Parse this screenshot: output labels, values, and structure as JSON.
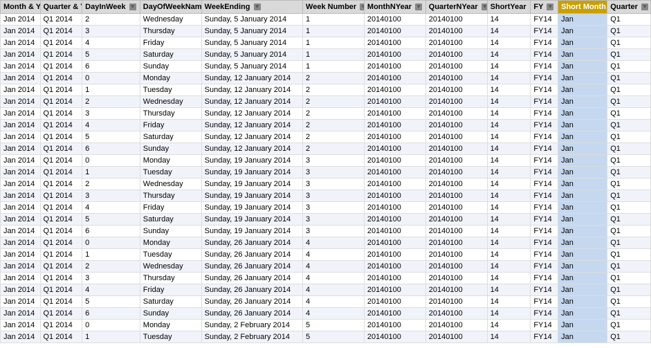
{
  "columns": [
    {
      "key": "month",
      "label": "Month & Year",
      "class": "col-month",
      "active": false
    },
    {
      "key": "quarter",
      "label": "Quarter & Year",
      "class": "col-quarter",
      "active": false
    },
    {
      "key": "dayinweek",
      "label": "DayInWeek",
      "class": "col-dayinweek",
      "active": false
    },
    {
      "key": "dayofweekname",
      "label": "DayOfWeekName",
      "class": "col-dayofweekname",
      "active": false
    },
    {
      "key": "weekending",
      "label": "WeekEnding",
      "class": "col-weekending",
      "active": false
    },
    {
      "key": "weeknumber",
      "label": "Week Number",
      "class": "col-weeknumber",
      "active": false
    },
    {
      "key": "monthnyear",
      "label": "MonthNYear",
      "class": "col-monthnyear",
      "active": false
    },
    {
      "key": "quarternyear",
      "label": "QuarterNYear",
      "class": "col-quarternyear",
      "active": false
    },
    {
      "key": "shortyear",
      "label": "ShortYear",
      "class": "col-shortyear",
      "active": false
    },
    {
      "key": "fy",
      "label": "FY",
      "class": "col-fy",
      "active": false
    },
    {
      "key": "shortmonth",
      "label": "Short Month",
      "class": "col-shortmonth",
      "active": true
    },
    {
      "key": "quarterend",
      "label": "Quarter",
      "class": "col-quarterend",
      "active": false
    }
  ],
  "rows": [
    {
      "month": "Jan 2014",
      "quarter": "Q1 2014",
      "dayinweek": "2",
      "dayofweekname": "Wednesday",
      "weekending": "Sunday, 5 January 2014",
      "weeknumber": "1",
      "monthnyear": "20140100",
      "quarternyear": "20140100",
      "shortyear": "14",
      "fy": "FY14",
      "shortmonth": "Jan",
      "quarterend": "Q1"
    },
    {
      "month": "Jan 2014",
      "quarter": "Q1 2014",
      "dayinweek": "3",
      "dayofweekname": "Thursday",
      "weekending": "Sunday, 5 January 2014",
      "weeknumber": "1",
      "monthnyear": "20140100",
      "quarternyear": "20140100",
      "shortyear": "14",
      "fy": "FY14",
      "shortmonth": "Jan",
      "quarterend": "Q1"
    },
    {
      "month": "Jan 2014",
      "quarter": "Q1 2014",
      "dayinweek": "4",
      "dayofweekname": "Friday",
      "weekending": "Sunday, 5 January 2014",
      "weeknumber": "1",
      "monthnyear": "20140100",
      "quarternyear": "20140100",
      "shortyear": "14",
      "fy": "FY14",
      "shortmonth": "Jan",
      "quarterend": "Q1"
    },
    {
      "month": "Jan 2014",
      "quarter": "Q1 2014",
      "dayinweek": "5",
      "dayofweekname": "Saturday",
      "weekending": "Sunday, 5 January 2014",
      "weeknumber": "1",
      "monthnyear": "20140100",
      "quarternyear": "20140100",
      "shortyear": "14",
      "fy": "FY14",
      "shortmonth": "Jan",
      "quarterend": "Q1"
    },
    {
      "month": "Jan 2014",
      "quarter": "Q1 2014",
      "dayinweek": "6",
      "dayofweekname": "Sunday",
      "weekending": "Sunday, 5 January 2014",
      "weeknumber": "1",
      "monthnyear": "20140100",
      "quarternyear": "20140100",
      "shortyear": "14",
      "fy": "FY14",
      "shortmonth": "Jan",
      "quarterend": "Q1"
    },
    {
      "month": "Jan 2014",
      "quarter": "Q1 2014",
      "dayinweek": "0",
      "dayofweekname": "Monday",
      "weekending": "Sunday, 12 January 2014",
      "weeknumber": "2",
      "monthnyear": "20140100",
      "quarternyear": "20140100",
      "shortyear": "14",
      "fy": "FY14",
      "shortmonth": "Jan",
      "quarterend": "Q1"
    },
    {
      "month": "Jan 2014",
      "quarter": "Q1 2014",
      "dayinweek": "1",
      "dayofweekname": "Tuesday",
      "weekending": "Sunday, 12 January 2014",
      "weeknumber": "2",
      "monthnyear": "20140100",
      "quarternyear": "20140100",
      "shortyear": "14",
      "fy": "FY14",
      "shortmonth": "Jan",
      "quarterend": "Q1"
    },
    {
      "month": "Jan 2014",
      "quarter": "Q1 2014",
      "dayinweek": "2",
      "dayofweekname": "Wednesday",
      "weekending": "Sunday, 12 January 2014",
      "weeknumber": "2",
      "monthnyear": "20140100",
      "quarternyear": "20140100",
      "shortyear": "14",
      "fy": "FY14",
      "shortmonth": "Jan",
      "quarterend": "Q1"
    },
    {
      "month": "Jan 2014",
      "quarter": "Q1 2014",
      "dayinweek": "3",
      "dayofweekname": "Thursday",
      "weekending": "Sunday, 12 January 2014",
      "weeknumber": "2",
      "monthnyear": "20140100",
      "quarternyear": "20140100",
      "shortyear": "14",
      "fy": "FY14",
      "shortmonth": "Jan",
      "quarterend": "Q1"
    },
    {
      "month": "Jan 2014",
      "quarter": "Q1 2014",
      "dayinweek": "4",
      "dayofweekname": "Friday",
      "weekending": "Sunday, 12 January 2014",
      "weeknumber": "2",
      "monthnyear": "20140100",
      "quarternyear": "20140100",
      "shortyear": "14",
      "fy": "FY14",
      "shortmonth": "Jan",
      "quarterend": "Q1"
    },
    {
      "month": "Jan 2014",
      "quarter": "Q1 2014",
      "dayinweek": "5",
      "dayofweekname": "Saturday",
      "weekending": "Sunday, 12 January 2014",
      "weeknumber": "2",
      "monthnyear": "20140100",
      "quarternyear": "20140100",
      "shortyear": "14",
      "fy": "FY14",
      "shortmonth": "Jan",
      "quarterend": "Q1"
    },
    {
      "month": "Jan 2014",
      "quarter": "Q1 2014",
      "dayinweek": "6",
      "dayofweekname": "Sunday",
      "weekending": "Sunday, 12 January 2014",
      "weeknumber": "2",
      "monthnyear": "20140100",
      "quarternyear": "20140100",
      "shortyear": "14",
      "fy": "FY14",
      "shortmonth": "Jan",
      "quarterend": "Q1"
    },
    {
      "month": "Jan 2014",
      "quarter": "Q1 2014",
      "dayinweek": "0",
      "dayofweekname": "Monday",
      "weekending": "Sunday, 19 January 2014",
      "weeknumber": "3",
      "monthnyear": "20140100",
      "quarternyear": "20140100",
      "shortyear": "14",
      "fy": "FY14",
      "shortmonth": "Jan",
      "quarterend": "Q1"
    },
    {
      "month": "Jan 2014",
      "quarter": "Q1 2014",
      "dayinweek": "1",
      "dayofweekname": "Tuesday",
      "weekending": "Sunday, 19 January 2014",
      "weeknumber": "3",
      "monthnyear": "20140100",
      "quarternyear": "20140100",
      "shortyear": "14",
      "fy": "FY14",
      "shortmonth": "Jan",
      "quarterend": "Q1"
    },
    {
      "month": "Jan 2014",
      "quarter": "Q1 2014",
      "dayinweek": "2",
      "dayofweekname": "Wednesday",
      "weekending": "Sunday, 19 January 2014",
      "weeknumber": "3",
      "monthnyear": "20140100",
      "quarternyear": "20140100",
      "shortyear": "14",
      "fy": "FY14",
      "shortmonth": "Jan",
      "quarterend": "Q1"
    },
    {
      "month": "Jan 2014",
      "quarter": "Q1 2014",
      "dayinweek": "3",
      "dayofweekname": "Thursday",
      "weekending": "Sunday, 19 January 2014",
      "weeknumber": "3",
      "monthnyear": "20140100",
      "quarternyear": "20140100",
      "shortyear": "14",
      "fy": "FY14",
      "shortmonth": "Jan",
      "quarterend": "Q1"
    },
    {
      "month": "Jan 2014",
      "quarter": "Q1 2014",
      "dayinweek": "4",
      "dayofweekname": "Friday",
      "weekending": "Sunday, 19 January 2014",
      "weeknumber": "3",
      "monthnyear": "20140100",
      "quarternyear": "20140100",
      "shortyear": "14",
      "fy": "FY14",
      "shortmonth": "Jan",
      "quarterend": "Q1"
    },
    {
      "month": "Jan 2014",
      "quarter": "Q1 2014",
      "dayinweek": "5",
      "dayofweekname": "Saturday",
      "weekending": "Sunday, 19 January 2014",
      "weeknumber": "3",
      "monthnyear": "20140100",
      "quarternyear": "20140100",
      "shortyear": "14",
      "fy": "FY14",
      "shortmonth": "Jan",
      "quarterend": "Q1"
    },
    {
      "month": "Jan 2014",
      "quarter": "Q1 2014",
      "dayinweek": "6",
      "dayofweekname": "Sunday",
      "weekending": "Sunday, 19 January 2014",
      "weeknumber": "3",
      "monthnyear": "20140100",
      "quarternyear": "20140100",
      "shortyear": "14",
      "fy": "FY14",
      "shortmonth": "Jan",
      "quarterend": "Q1"
    },
    {
      "month": "Jan 2014",
      "quarter": "Q1 2014",
      "dayinweek": "0",
      "dayofweekname": "Monday",
      "weekending": "Sunday, 26 January 2014",
      "weeknumber": "4",
      "monthnyear": "20140100",
      "quarternyear": "20140100",
      "shortyear": "14",
      "fy": "FY14",
      "shortmonth": "Jan",
      "quarterend": "Q1"
    },
    {
      "month": "Jan 2014",
      "quarter": "Q1 2014",
      "dayinweek": "1",
      "dayofweekname": "Tuesday",
      "weekending": "Sunday, 26 January 2014",
      "weeknumber": "4",
      "monthnyear": "20140100",
      "quarternyear": "20140100",
      "shortyear": "14",
      "fy": "FY14",
      "shortmonth": "Jan",
      "quarterend": "Q1"
    },
    {
      "month": "Jan 2014",
      "quarter": "Q1 2014",
      "dayinweek": "2",
      "dayofweekname": "Wednesday",
      "weekending": "Sunday, 26 January 2014",
      "weeknumber": "4",
      "monthnyear": "20140100",
      "quarternyear": "20140100",
      "shortyear": "14",
      "fy": "FY14",
      "shortmonth": "Jan",
      "quarterend": "Q1"
    },
    {
      "month": "Jan 2014",
      "quarter": "Q1 2014",
      "dayinweek": "3",
      "dayofweekname": "Thursday",
      "weekending": "Sunday, 26 January 2014",
      "weeknumber": "4",
      "monthnyear": "20140100",
      "quarternyear": "20140100",
      "shortyear": "14",
      "fy": "FY14",
      "shortmonth": "Jan",
      "quarterend": "Q1"
    },
    {
      "month": "Jan 2014",
      "quarter": "Q1 2014",
      "dayinweek": "4",
      "dayofweekname": "Friday",
      "weekending": "Sunday, 26 January 2014",
      "weeknumber": "4",
      "monthnyear": "20140100",
      "quarternyear": "20140100",
      "shortyear": "14",
      "fy": "FY14",
      "shortmonth": "Jan",
      "quarterend": "Q1"
    },
    {
      "month": "Jan 2014",
      "quarter": "Q1 2014",
      "dayinweek": "5",
      "dayofweekname": "Saturday",
      "weekending": "Sunday, 26 January 2014",
      "weeknumber": "4",
      "monthnyear": "20140100",
      "quarternyear": "20140100",
      "shortyear": "14",
      "fy": "FY14",
      "shortmonth": "Jan",
      "quarterend": "Q1"
    },
    {
      "month": "Jan 2014",
      "quarter": "Q1 2014",
      "dayinweek": "6",
      "dayofweekname": "Sunday",
      "weekending": "Sunday, 26 January 2014",
      "weeknumber": "4",
      "monthnyear": "20140100",
      "quarternyear": "20140100",
      "shortyear": "14",
      "fy": "FY14",
      "shortmonth": "Jan",
      "quarterend": "Q1"
    },
    {
      "month": "Jan 2014",
      "quarter": "Q1 2014",
      "dayinweek": "0",
      "dayofweekname": "Monday",
      "weekending": "Sunday, 2 February 2014",
      "weeknumber": "5",
      "monthnyear": "20140100",
      "quarternyear": "20140100",
      "shortyear": "14",
      "fy": "FY14",
      "shortmonth": "Jan",
      "quarterend": "Q1"
    },
    {
      "month": "Jan 2014",
      "quarter": "Q1 2014",
      "dayinweek": "1",
      "dayofweekname": "Tuesday",
      "weekending": "Sunday, 2 February 2014",
      "weeknumber": "5",
      "monthnyear": "20140100",
      "quarternyear": "20140100",
      "shortyear": "14",
      "fy": "FY14",
      "shortmonth": "Jan",
      "quarterend": "Q1"
    }
  ]
}
